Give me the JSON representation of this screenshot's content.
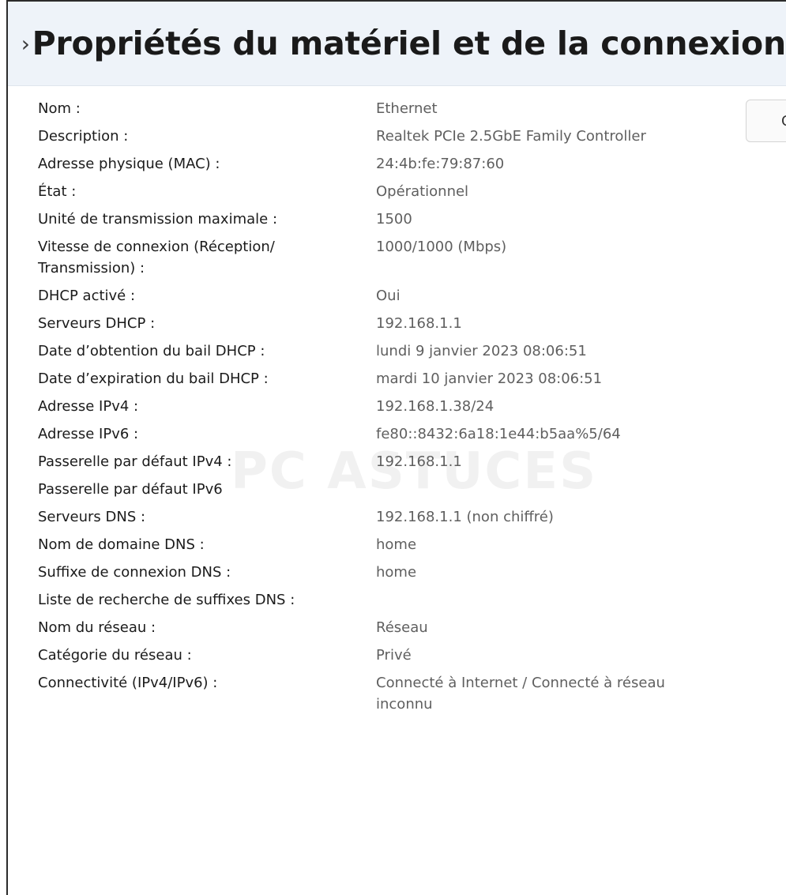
{
  "header": {
    "title": "Propriétés du matériel et de la connexion"
  },
  "copy_button": {
    "label": "C"
  },
  "watermark": {
    "text": "PC ASTUCES"
  },
  "properties": [
    {
      "label": "Nom :",
      "value": "Ethernet"
    },
    {
      "label": "Description :",
      "value": "Realtek PCIe 2.5GbE Family Controller"
    },
    {
      "label": "Adresse physique (MAC) :",
      "value": "24:4b:fe:79:87:60"
    },
    {
      "label": "État :",
      "value": "Opérationnel"
    },
    {
      "label": "Unité de transmission maximale :",
      "value": "1500"
    },
    {
      "label": "Vitesse de connexion (Réception/ Transmission) :",
      "value": "1000/1000 (Mbps)"
    },
    {
      "label": "DHCP activé :",
      "value": "Oui"
    },
    {
      "label": "Serveurs DHCP :",
      "value": "192.168.1.1"
    },
    {
      "label": "Date d’obtention du bail DHCP :",
      "value": "lundi 9 janvier 2023 08:06:51"
    },
    {
      "label": "Date d’expiration du bail DHCP :",
      "value": "mardi 10 janvier 2023 08:06:51"
    },
    {
      "label": "Adresse IPv4 :",
      "value": "192.168.1.38/24"
    },
    {
      "label": "Adresse IPv6 :",
      "value": "fe80::8432:6a18:1e44:b5aa%5/64"
    },
    {
      "label": "Passerelle par défaut IPv4 :",
      "value": "192.168.1.1"
    },
    {
      "label": "Passerelle par défaut IPv6",
      "value": ""
    },
    {
      "label": "Serveurs DNS :",
      "value": "192.168.1.1 (non chiffré)"
    },
    {
      "label": "Nom de domaine DNS :",
      "value": "home"
    },
    {
      "label": "Suffixe de connexion DNS :",
      "value": "home"
    },
    {
      "label": "Liste de recherche de suffixes DNS :",
      "value": ""
    },
    {
      "label": "Nom du réseau :",
      "value": "Réseau"
    },
    {
      "label": "Catégorie du réseau :",
      "value": "Privé"
    },
    {
      "label": "Connectivité (IPv4/IPv6) :",
      "value": "Connecté à Internet / Connecté à réseau inconnu"
    }
  ]
}
